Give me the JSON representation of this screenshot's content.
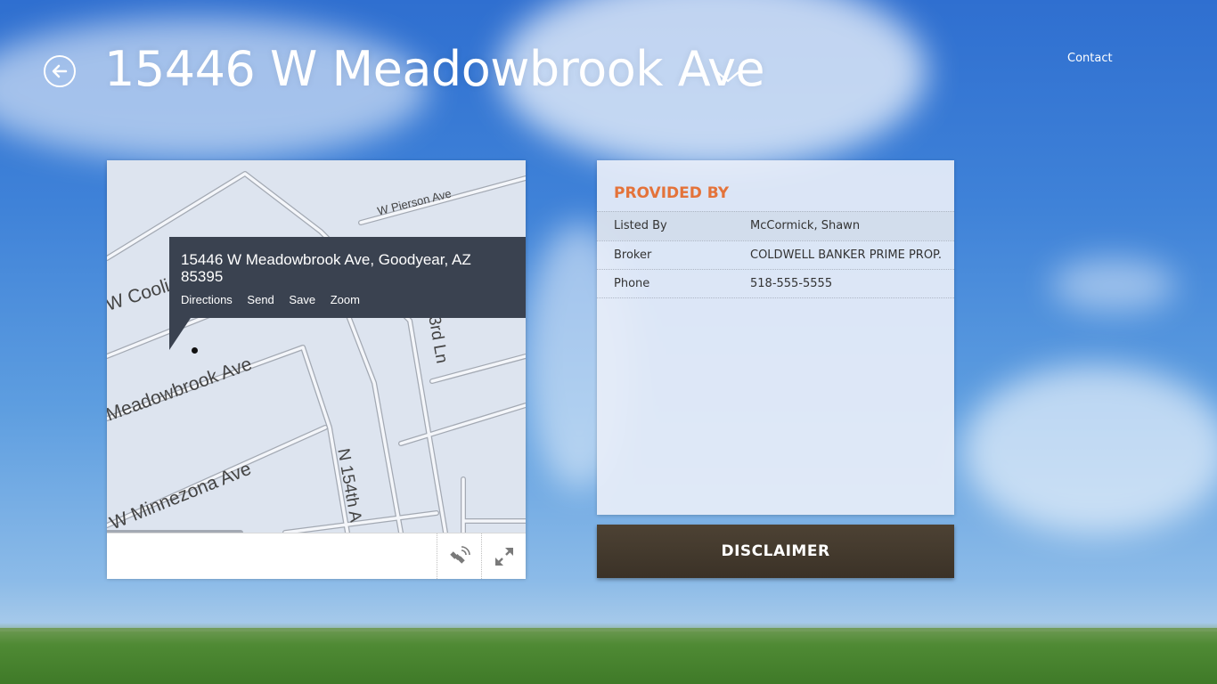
{
  "header": {
    "title": "15446 W Meadowbrook Ave",
    "contact_label": "Contact"
  },
  "map": {
    "popup_address": "15446 W Meadowbrook Ave, Goodyear, AZ 85395",
    "actions": [
      "Directions",
      "Send",
      "Save",
      "Zoom"
    ],
    "street_labels": [
      "W Pierson Ave",
      "W Coolid",
      "Meadowbrook Ave",
      "W Minnezona Ave",
      "N 154th A",
      "3rd Ln"
    ],
    "toolbar_icons": [
      "satellite-icon",
      "expand-icon"
    ]
  },
  "info": {
    "section_title": "PROVIDED BY",
    "rows": [
      {
        "label": "Listed By",
        "value": "McCormick, Shawn"
      },
      {
        "label": "Broker",
        "value": "COLDWELL BANKER PRIME PROP."
      },
      {
        "label": "Phone",
        "value": "518-555-5555"
      }
    ]
  },
  "disclaimer_label": "DISCLAIMER",
  "colors": {
    "accent_orange": "#e4733a",
    "popup_bg": "#3a4250",
    "disclaimer_bg": "#3f3529"
  }
}
